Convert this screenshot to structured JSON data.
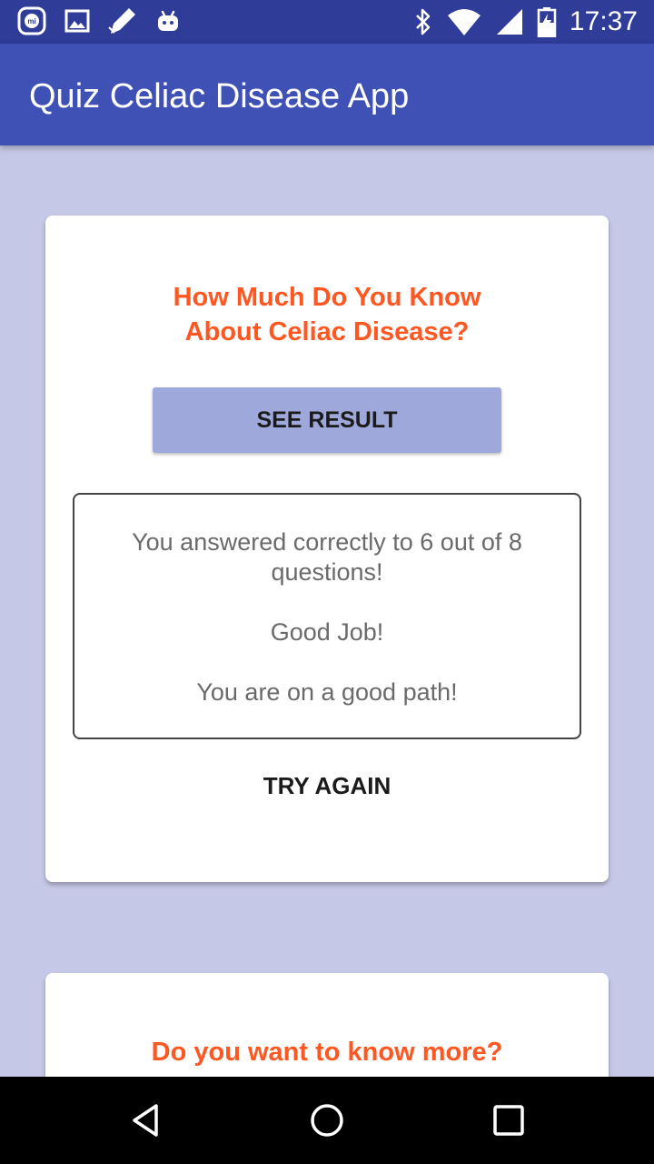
{
  "status_bar": {
    "time": "17:37",
    "left_icons": [
      "mi-icon",
      "image-icon",
      "pen-icon",
      "android-icon"
    ],
    "right_icons": [
      "bluetooth-icon",
      "wifi-icon",
      "signal-icon",
      "battery-charging-icon"
    ]
  },
  "app_bar": {
    "title": "Quiz Celiac Disease App"
  },
  "result_card": {
    "title_line1": "How Much Do You Know",
    "title_line2": "About Celiac Disease?",
    "see_result_label": "SEE RESULT",
    "result_line1": "You answered correctly to 6 out of 8",
    "result_line2": "questions!",
    "result_line3": "Good Job!",
    "result_line4": "You are on a good path!",
    "try_again_label": "TRY AGAIN"
  },
  "more_card": {
    "title_line1": "Do you want to know more?"
  },
  "nav_bar": {
    "icons": [
      "back-icon",
      "home-icon",
      "recents-icon"
    ]
  },
  "colors": {
    "status_bar": "#2f3c98",
    "app_bar": "#3f51b5",
    "background": "#c5c8e6",
    "accent_title": "#ff5722",
    "button": "#9fa8da"
  }
}
